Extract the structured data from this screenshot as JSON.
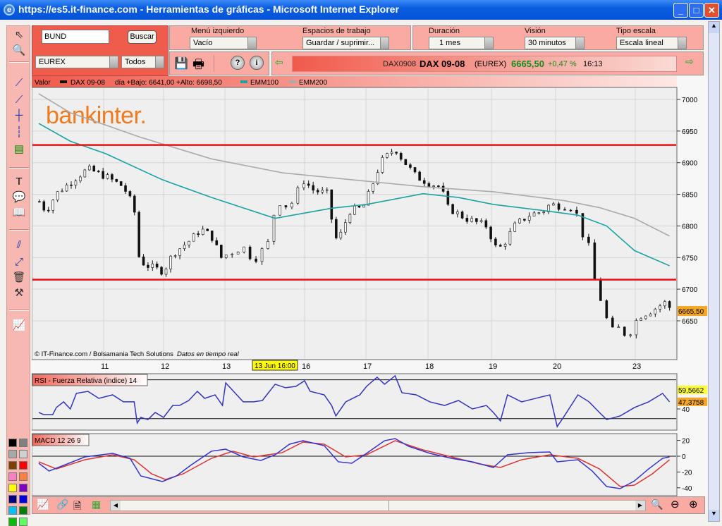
{
  "window": {
    "title": "https://es5.it-finance.com - Herramientas de gráficas - Microsoft Internet Explorer",
    "minimize": "_",
    "maximize": "□",
    "close": "✕"
  },
  "search": {
    "value": "BUND",
    "button": "Buscar",
    "market": "EUREX",
    "filter": "Todos"
  },
  "menus": {
    "left_menu": {
      "label": "Menú izquierdo",
      "value": "Vacío"
    },
    "workspaces": {
      "label": "Espacios de trabajo",
      "value": "Guardar / suprimir..."
    },
    "duration": {
      "label": "Duración",
      "value": "1 mes"
    },
    "vision": {
      "label": "Visión",
      "value": "30 minutos"
    },
    "scale": {
      "label": "Tipo escala",
      "value": "Escala lineal"
    }
  },
  "toolbar_icons": {
    "save": "💾",
    "print": "🖶",
    "help": "?",
    "info": "i"
  },
  "quote": {
    "code": "DAX0908",
    "name": "DAX 09-08",
    "exchange": "(EUREX)",
    "price": "6665,50",
    "change": "+0,47 %",
    "time": "16:13"
  },
  "legend": {
    "valor": "Valor",
    "series": "DAX 09-08",
    "range": "día +Bajo: 6641,00 +Alto: 6698,50",
    "ema100": "EMM100",
    "ema200": "EMM200"
  },
  "brand": "bankinter.",
  "credits": {
    "copyright": "© IT-Finance.com / Bolsamania Tech Solutions",
    "realtime": "Datos en tiempo real"
  },
  "cursor_label": "13 Jun 16:00",
  "colors": {
    "ema100": "#1aa3a3",
    "ema200": "#aaaaaa",
    "rsi": "#3333bb",
    "macd": "#3333cc",
    "signal": "#dd3333",
    "resistance": "#ee1111"
  },
  "chart_data": [
    {
      "type": "candlestick",
      "title": "DAX 09-08",
      "ylim": [
        6600,
        7020
      ],
      "yticks": [
        7000,
        6950,
        6900,
        6850,
        6800,
        6750,
        6700,
        6650
      ],
      "xticks": [
        {
          "i": 1,
          "label": "11"
        },
        {
          "i": 2,
          "label": "12"
        },
        {
          "i": 3,
          "label": "13"
        },
        {
          "i": 4,
          "label": "16"
        },
        {
          "i": 5,
          "label": "17"
        },
        {
          "i": 6,
          "label": "18"
        },
        {
          "i": 7,
          "label": "19"
        },
        {
          "i": 8,
          "label": "20"
        },
        {
          "i": 9,
          "label": "23"
        }
      ],
      "last_value_label": "6665,50",
      "horizontal_lines": [
        6928,
        6715
      ],
      "close_path": [
        [
          -0.07,
          6840
        ],
        [
          0.05,
          6823
        ],
        [
          0.22,
          6851
        ],
        [
          0.57,
          6878
        ],
        [
          0.74,
          6890
        ],
        [
          1.04,
          6878
        ],
        [
          1.33,
          6862
        ],
        [
          1.51,
          6829
        ],
        [
          1.56,
          6756
        ],
        [
          1.68,
          6739
        ],
        [
          2.0,
          6728
        ],
        [
          2.15,
          6756
        ],
        [
          2.44,
          6778
        ],
        [
          2.61,
          6795
        ],
        [
          2.78,
          6784
        ],
        [
          2.94,
          6750
        ],
        [
          3.23,
          6767
        ],
        [
          3.36,
          6745
        ],
        [
          3.54,
          6773
        ],
        [
          3.65,
          6840
        ],
        [
          3.81,
          6829
        ],
        [
          3.98,
          6872
        ],
        [
          4.15,
          6856
        ],
        [
          4.38,
          6851
        ],
        [
          4.49,
          6778
        ],
        [
          4.61,
          6789
        ],
        [
          4.72,
          6823
        ],
        [
          4.95,
          6829
        ],
        [
          5.07,
          6856
        ],
        [
          5.24,
          6901
        ],
        [
          5.47,
          6923
        ],
        [
          5.58,
          6906
        ],
        [
          5.81,
          6878
        ],
        [
          6.03,
          6867
        ],
        [
          6.2,
          6862
        ],
        [
          6.31,
          6829
        ],
        [
          6.59,
          6812
        ],
        [
          6.92,
          6800
        ],
        [
          7.09,
          6761
        ],
        [
          7.2,
          6773
        ],
        [
          7.36,
          6800
        ],
        [
          7.58,
          6817
        ],
        [
          7.8,
          6823
        ],
        [
          7.91,
          6834
        ],
        [
          8.24,
          6829
        ],
        [
          8.33,
          6789
        ],
        [
          8.46,
          6756
        ],
        [
          8.5,
          6700
        ],
        [
          8.59,
          6678
        ],
        [
          8.68,
          6633
        ],
        [
          8.81,
          6639
        ],
        [
          8.9,
          6624
        ],
        [
          9.04,
          6656
        ],
        [
          9.27,
          6667
        ],
        [
          9.49,
          6680
        ],
        [
          9.57,
          6666
        ]
      ],
      "series": [
        {
          "name": "EMM100",
          "values": [
            [
              -0.07,
              6962
            ],
            [
              0.45,
              6934
            ],
            [
              1.04,
              6914
            ],
            [
              1.98,
              6873
            ],
            [
              2.78,
              6845
            ],
            [
              3.63,
              6812
            ],
            [
              4.44,
              6828
            ],
            [
              5.01,
              6834
            ],
            [
              5.92,
              6851
            ],
            [
              6.48,
              6845
            ],
            [
              7.03,
              6834
            ],
            [
              7.91,
              6823
            ],
            [
              8.28,
              6817
            ],
            [
              8.64,
              6800
            ],
            [
              8.99,
              6761
            ],
            [
              9.54,
              6737
            ]
          ]
        },
        {
          "name": "EMM200",
          "values": [
            [
              -0.07,
              7009
            ],
            [
              0.45,
              6979
            ],
            [
              1.62,
              6940
            ],
            [
              2.78,
              6906
            ],
            [
              3.72,
              6884
            ],
            [
              4.77,
              6873
            ],
            [
              5.92,
              6862
            ],
            [
              7.03,
              6854
            ],
            [
              8.11,
              6840
            ],
            [
              8.55,
              6829
            ],
            [
              8.99,
              6812
            ],
            [
              9.54,
              6784
            ]
          ]
        }
      ]
    },
    {
      "type": "line",
      "title": "RSI - Fuerza Relativa (indice) 14",
      "ylim": [
        18,
        76
      ],
      "yticks": [
        40
      ],
      "levels": [
        70,
        30
      ],
      "value_labels": [
        "59,5662",
        "47,3758"
      ],
      "series": [
        {
          "name": "RSI",
          "values": [
            [
              -0.07,
              36.4
            ],
            [
              0.01,
              34.2
            ],
            [
              0.16,
              34.2
            ],
            [
              0.22,
              41.5
            ],
            [
              0.34,
              47.3
            ],
            [
              0.45,
              40
            ],
            [
              0.55,
              56
            ],
            [
              0.74,
              58.1
            ],
            [
              0.92,
              50.9
            ],
            [
              1.15,
              54.5
            ],
            [
              1.33,
              47.3
            ],
            [
              1.51,
              47.3
            ],
            [
              1.56,
              25.5
            ],
            [
              1.62,
              31.3
            ],
            [
              1.74,
              29.1
            ],
            [
              1.86,
              36.4
            ],
            [
              2.0,
              31.3
            ],
            [
              2.15,
              43.6
            ],
            [
              2.26,
              43.6
            ],
            [
              2.41,
              48.7
            ],
            [
              2.55,
              58.1
            ],
            [
              2.67,
              50.9
            ],
            [
              2.84,
              54.5
            ],
            [
              2.96,
              43.6
            ],
            [
              3.01,
              66.8
            ],
            [
              3.23,
              47.3
            ],
            [
              3.36,
              47.3
            ],
            [
              3.47,
              48.7
            ],
            [
              3.63,
              65.4
            ],
            [
              3.76,
              61.8
            ],
            [
              3.89,
              63.2
            ],
            [
              4.0,
              69
            ],
            [
              4.09,
              58.1
            ],
            [
              4.32,
              54.5
            ],
            [
              4.44,
              43.6
            ],
            [
              4.51,
              32.8
            ],
            [
              4.67,
              47.3
            ],
            [
              4.9,
              54.5
            ],
            [
              5.01,
              63.2
            ],
            [
              5.18,
              72.6
            ],
            [
              5.3,
              65.4
            ],
            [
              5.47,
              74.1
            ],
            [
              5.58,
              56.7
            ],
            [
              5.81,
              54.5
            ],
            [
              6.03,
              47.3
            ],
            [
              6.26,
              43.6
            ],
            [
              6.48,
              48.7
            ],
            [
              6.7,
              40
            ],
            [
              6.92,
              43.6
            ],
            [
              7.03,
              36.4
            ],
            [
              7.14,
              27.7
            ],
            [
              7.25,
              54.5
            ],
            [
              7.47,
              47.3
            ],
            [
              7.69,
              50.9
            ],
            [
              7.91,
              54.5
            ],
            [
              8.02,
              21.9
            ],
            [
              8.11,
              32.8
            ],
            [
              8.28,
              54.5
            ],
            [
              8.42,
              47.3
            ],
            [
              8.55,
              36.4
            ],
            [
              8.64,
              29.1
            ],
            [
              8.81,
              32.8
            ],
            [
              8.99,
              41.5
            ],
            [
              9.21,
              47.3
            ],
            [
              9.43,
              56
            ],
            [
              9.54,
              47.3
            ]
          ]
        }
      ]
    },
    {
      "type": "line",
      "title": "MACD 12 26 9",
      "ylim": [
        -48,
        28
      ],
      "yticks": [
        20,
        0,
        -20,
        -40
      ],
      "series": [
        {
          "name": "MACD",
          "values": [
            [
              -0.07,
              -8.9
            ],
            [
              0.1,
              -18.8
            ],
            [
              0.34,
              -11.6
            ],
            [
              0.69,
              -0.9
            ],
            [
              1.15,
              3.6
            ],
            [
              1.44,
              -2.7
            ],
            [
              1.62,
              -25
            ],
            [
              1.98,
              -32.1
            ],
            [
              2.21,
              -25
            ],
            [
              2.44,
              -11.6
            ],
            [
              2.78,
              6.3
            ],
            [
              3.01,
              8.9
            ],
            [
              3.23,
              -0.9
            ],
            [
              3.45,
              -5.4
            ],
            [
              3.63,
              1.8
            ],
            [
              3.81,
              15.2
            ],
            [
              3.98,
              19.6
            ],
            [
              4.32,
              13.4
            ],
            [
              4.55,
              -7.1
            ],
            [
              4.77,
              -8.9
            ],
            [
              5.01,
              3.6
            ],
            [
              5.3,
              19.6
            ],
            [
              5.47,
              22.3
            ],
            [
              5.69,
              12.5
            ],
            [
              6.03,
              3.6
            ],
            [
              6.37,
              -2.7
            ],
            [
              6.7,
              -7.1
            ],
            [
              7.03,
              -14.3
            ],
            [
              7.25,
              1.8
            ],
            [
              7.58,
              4.5
            ],
            [
              7.91,
              5.4
            ],
            [
              8.02,
              -7.1
            ],
            [
              8.28,
              -4.5
            ],
            [
              8.46,
              -18.8
            ],
            [
              8.64,
              -38.4
            ],
            [
              8.81,
              -41.1
            ],
            [
              8.99,
              -31.3
            ],
            [
              9.21,
              -16.1
            ],
            [
              9.43,
              -2.7
            ],
            [
              9.54,
              -0.9
            ]
          ]
        },
        {
          "name": "Signal",
          "values": [
            [
              -0.07,
              -7.1
            ],
            [
              0.22,
              -16.1
            ],
            [
              0.69,
              -4.5
            ],
            [
              1.15,
              1.8
            ],
            [
              1.51,
              -4.5
            ],
            [
              1.8,
              -22.3
            ],
            [
              2.03,
              -29.5
            ],
            [
              2.32,
              -22.3
            ],
            [
              2.78,
              -2.7
            ],
            [
              3.1,
              6.3
            ],
            [
              3.36,
              -0.9
            ],
            [
              3.72,
              4.5
            ],
            [
              3.98,
              17.9
            ],
            [
              4.32,
              15.2
            ],
            [
              4.67,
              -0.9
            ],
            [
              5.01,
              1.8
            ],
            [
              5.47,
              19.6
            ],
            [
              5.92,
              8
            ],
            [
              6.37,
              -0.9
            ],
            [
              6.81,
              -9.8
            ],
            [
              7.14,
              -14.3
            ],
            [
              7.47,
              -4.5
            ],
            [
              7.91,
              1.8
            ],
            [
              8.28,
              -2.7
            ],
            [
              8.55,
              -16.1
            ],
            [
              8.81,
              -38.4
            ],
            [
              8.99,
              -36.6
            ],
            [
              9.27,
              -22.3
            ],
            [
              9.54,
              -4.5
            ]
          ]
        }
      ]
    }
  ],
  "palette": [
    "#000000",
    "#808080",
    "#a8a8a8",
    "#d0d0d0",
    "#804000",
    "#ff0000",
    "#ff80c0",
    "#ff8040",
    "#ffff00",
    "#8000c0",
    "#000080",
    "#0000e0",
    "#00c0ff",
    "#008000",
    "#00c000",
    "#60ff60"
  ]
}
